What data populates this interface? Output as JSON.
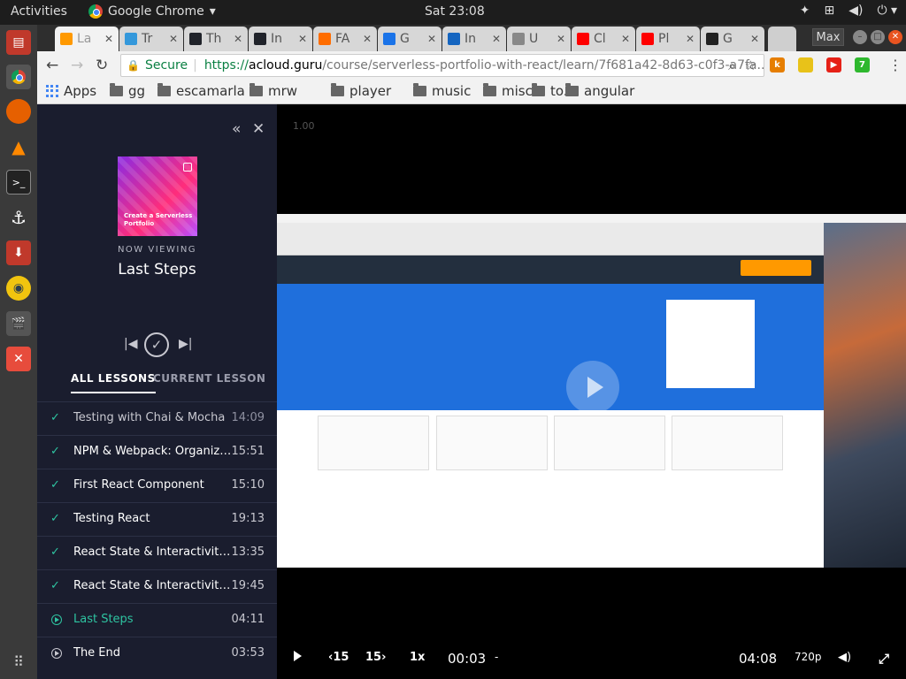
{
  "topbar": {
    "activities": "Activities",
    "app_name": "Google Chrome",
    "app_menu_arrow": "▾",
    "clock": "Sat 23:08"
  },
  "tabs": [
    {
      "label": "La",
      "color": "#ff9900",
      "active": true
    },
    {
      "label": "Tr",
      "color": "#3498db"
    },
    {
      "label": "Th",
      "color": "#20232a"
    },
    {
      "label": "In",
      "color": "#20232a"
    },
    {
      "label": "FA",
      "color": "#ff6d00"
    },
    {
      "label": "G",
      "color": "#1a73e8"
    },
    {
      "label": "In",
      "color": "#1565c0"
    },
    {
      "label": "U",
      "color": "#888888"
    },
    {
      "label": "Cl",
      "color": "#ff0000"
    },
    {
      "label": "Pl",
      "color": "#ff0000"
    },
    {
      "label": "G",
      "color": "#222222"
    }
  ],
  "window": {
    "max_label": "Max"
  },
  "toolbar": {
    "secure": "Secure",
    "url_scheme": "https://",
    "url_host": "acloud.guru",
    "url_path": "/course/serverless-portfolio-with-react/learn/7f681a42-8d63-c0f3-a7fa..."
  },
  "extensions": [
    {
      "label": "k",
      "color": "#e67e00"
    },
    {
      "label": "",
      "color": "#e8c219"
    },
    {
      "label": "▶",
      "color": "#e62117"
    },
    {
      "label": "7",
      "color": "#2eb82e"
    }
  ],
  "bookmarks": {
    "apps": "Apps",
    "folders": [
      "gg",
      "escamarla",
      "mrw",
      "player",
      "music",
      "miscs",
      "to...",
      "angular"
    ]
  },
  "course": {
    "cover_title": "Create a Serverless Portfolio",
    "now_viewing": "NOW VIEWING",
    "lesson_title": "Last Steps",
    "tab_all": "ALL LESSONS",
    "tab_current": "CURRENT LESSON",
    "lessons": [
      {
        "name": "Testing with Chai & Mocha",
        "duration": "14:09",
        "state": "done-dim"
      },
      {
        "name": "NPM & Webpack: Organizing Your Code",
        "duration": "15:51",
        "state": "done"
      },
      {
        "name": "First React Component",
        "duration": "15:10",
        "state": "done"
      },
      {
        "name": "Testing React",
        "duration": "19:13",
        "state": "done"
      },
      {
        "name": "React State & Interactivity Part 1",
        "duration": "13:35",
        "state": "done"
      },
      {
        "name": "React State & Interactivity Part 2",
        "duration": "19:45",
        "state": "done"
      },
      {
        "name": "Last Steps",
        "duration": "04:11",
        "state": "current"
      },
      {
        "name": "The End",
        "duration": "03:53",
        "state": "todo"
      }
    ]
  },
  "video": {
    "speed_label": "1.00",
    "rewind": "‹15",
    "forward": "15›",
    "rate": "1x",
    "current_time": "00:03",
    "remaining": "04:08",
    "quality": "720p"
  }
}
